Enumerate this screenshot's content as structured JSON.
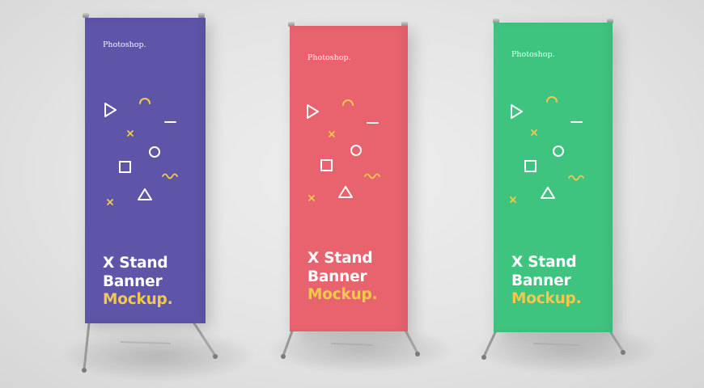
{
  "banners": [
    {
      "brand": "Photoshop.",
      "title_line1": "X Stand",
      "title_line2": "Banner",
      "title_line3": "Mockup.",
      "background_color": "#5e55a8",
      "accent_color": "#f2c94c"
    },
    {
      "brand": "Photoshop.",
      "title_line1": "X Stand",
      "title_line2": "Banner",
      "title_line3": "Mockup.",
      "background_color": "#e8636e",
      "accent_color": "#f2c94c"
    },
    {
      "brand": "Photoshop.",
      "title_line1": "X Stand",
      "title_line2": "Banner",
      "title_line3": "Mockup.",
      "background_color": "#3fc47f",
      "accent_color": "#f2c94c"
    }
  ],
  "icons": [
    "play-triangle-icon",
    "arc-icon",
    "dash-icon",
    "cross-icon",
    "circle-icon",
    "square-icon",
    "wave-icon",
    "triangle-icon"
  ]
}
